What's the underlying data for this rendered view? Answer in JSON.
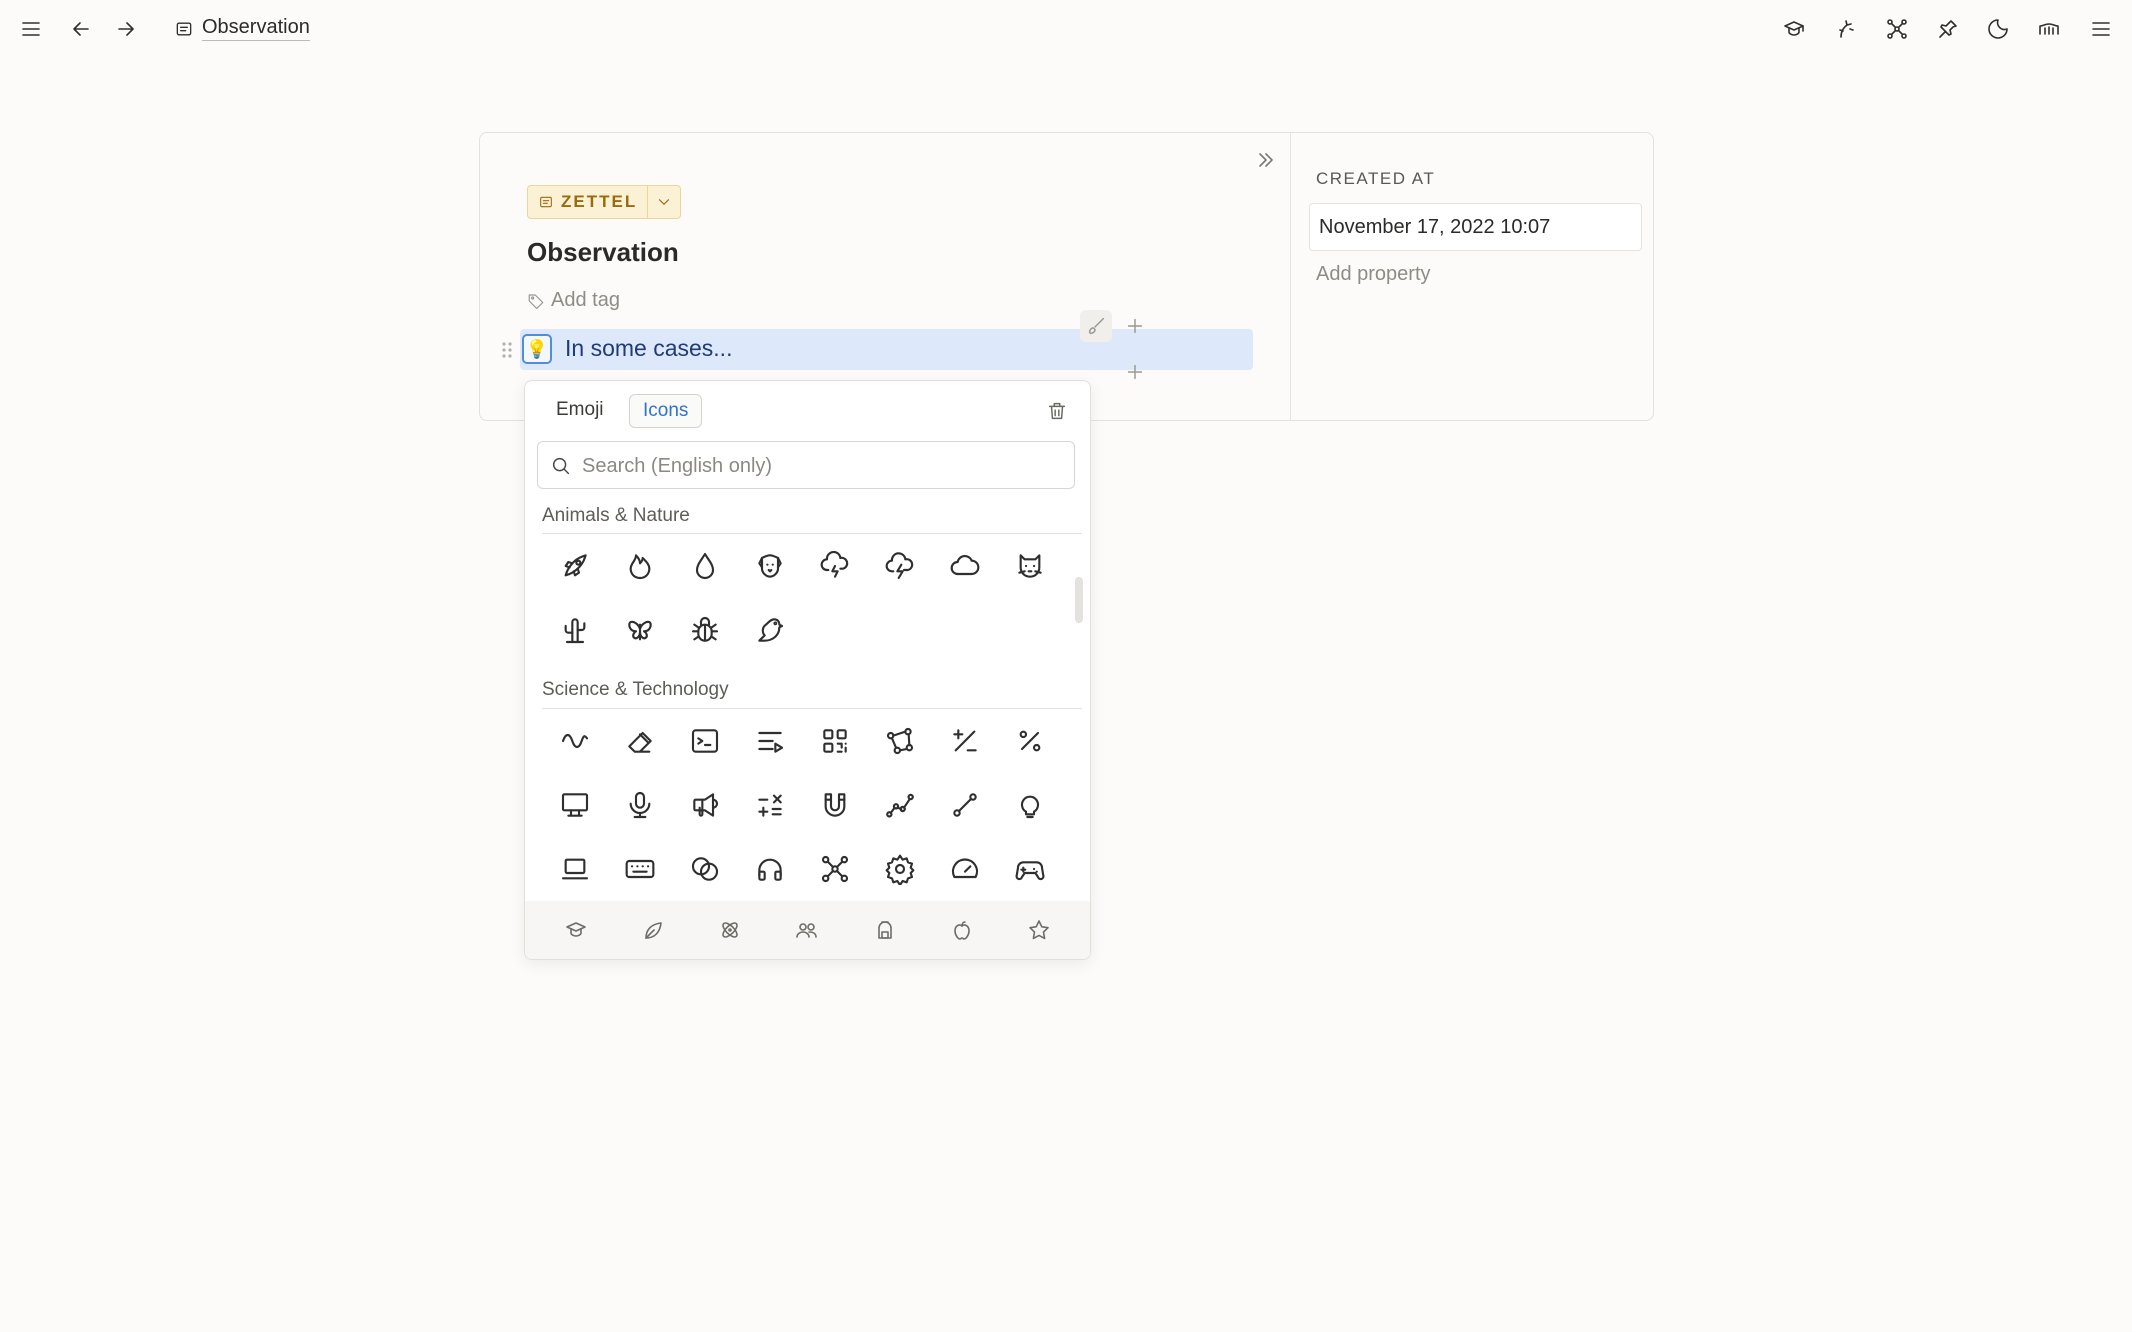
{
  "breadcrumb": {
    "page_title": "Observation"
  },
  "topbar": {
    "left_icons": [
      "menu-icon",
      "arrow-left-icon",
      "arrow-right-icon"
    ],
    "right_icons": [
      "graduation-cap-icon",
      "quick-capture-icon",
      "graph-icon",
      "pin-icon",
      "moon-icon",
      "library-icon",
      "menu-icon"
    ]
  },
  "page": {
    "type_label": "ZETTEL",
    "title": "Observation",
    "add_tag": "Add tag",
    "block_icon": "💡",
    "block_text": "In some cases..."
  },
  "properties": {
    "created_label": "CREATED AT",
    "created_value": "November 17, 2022 10:07",
    "add_property": "Add property"
  },
  "picker": {
    "tabs": [
      "Emoji",
      "Icons"
    ],
    "active_tab": "Icons",
    "search_placeholder": "Search (English only)",
    "sections": [
      {
        "title": "Animals & Nature",
        "icons": [
          "rocket-icon",
          "flame-icon",
          "droplet-icon",
          "dog-icon",
          "cloud-storm-icon",
          "cloud-bolt-icon",
          "cloud-icon",
          "cat-icon",
          "cactus-icon",
          "butterfly-icon",
          "bug-icon",
          "bird-icon"
        ]
      },
      {
        "title": "Science & Technology",
        "icons": [
          "wave-sine-icon",
          "eraser-icon",
          "terminal-icon",
          "playlist-icon",
          "qrcode-icon",
          "vector-icon",
          "plus-minus-icon",
          "percentage-icon",
          "device-desktop-icon",
          "microphone-icon",
          "speakerphone-icon",
          "math-symbols-icon",
          "magnet-icon",
          "chart-line-icon",
          "line-icon",
          "bulb-icon",
          "laptop-icon",
          "keyboard-icon",
          "brand-venn-icon",
          "headphones-icon",
          "molecule-icon",
          "settings-icon",
          "gauge-icon",
          "gamepad-icon"
        ]
      }
    ],
    "category_icons": [
      "graduation-cap-icon",
      "leaf-icon",
      "atom-icon",
      "users-icon",
      "backpack-icon",
      "apple-icon",
      "star-icon"
    ]
  }
}
